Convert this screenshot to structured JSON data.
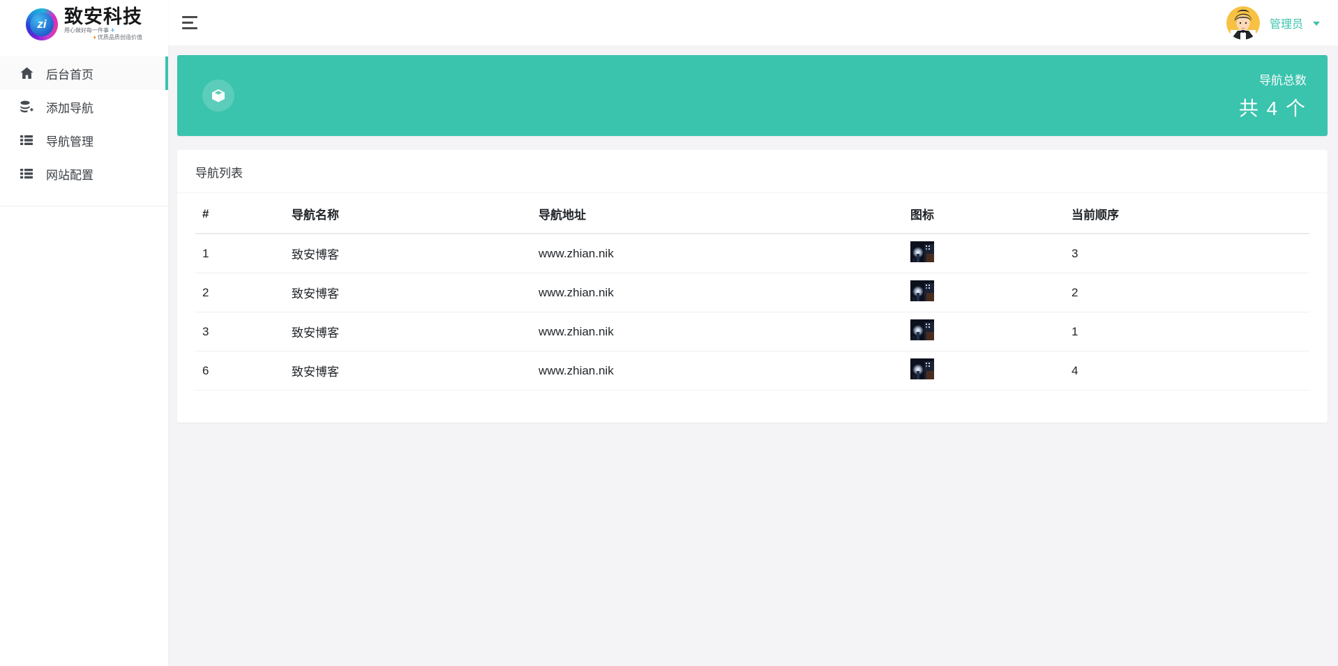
{
  "brand": {
    "name": "致安科技",
    "logo_monogram": "zi",
    "tagline1": "用心做好每一件事",
    "tagline1_icon": "✈",
    "tagline2": "优质品质创造价值",
    "tagline2_icon": "♦"
  },
  "topbar": {
    "user_name": "管理员"
  },
  "sidebar": {
    "items": [
      {
        "label": "后台首页",
        "icon": "home-icon",
        "active": true
      },
      {
        "label": "添加导航",
        "icon": "database-plus-icon",
        "active": false
      },
      {
        "label": "导航管理",
        "icon": "table-list-icon",
        "active": false
      },
      {
        "label": "网站配置",
        "icon": "table-list-icon",
        "active": false
      }
    ]
  },
  "banner": {
    "icon": "cube-icon",
    "label": "导航总数",
    "count": 4,
    "count_text": "共 4 个",
    "background_color": "#3ac3ad"
  },
  "panel": {
    "title": "导航列表"
  },
  "table": {
    "columns": [
      "#",
      "导航名称",
      "导航地址",
      "图标",
      "当前顺序"
    ],
    "rows": [
      {
        "id": "1",
        "name": "致安博客",
        "url": "www.zhian.nik",
        "icon": "night-photo-thumbnail",
        "order": "3"
      },
      {
        "id": "2",
        "name": "致安博客",
        "url": "www.zhian.nik",
        "icon": "night-photo-thumbnail",
        "order": "2"
      },
      {
        "id": "3",
        "name": "致安博客",
        "url": "www.zhian.nik",
        "icon": "night-photo-thumbnail",
        "order": "1"
      },
      {
        "id": "6",
        "name": "致安博客",
        "url": "www.zhian.nik",
        "icon": "night-photo-thumbnail",
        "order": "4"
      }
    ]
  },
  "colors": {
    "accent_teal": "#3ac3ad",
    "page_background": "#f4f4f6",
    "sidebar_background": "#ffffff",
    "text_dark": "#212529"
  }
}
